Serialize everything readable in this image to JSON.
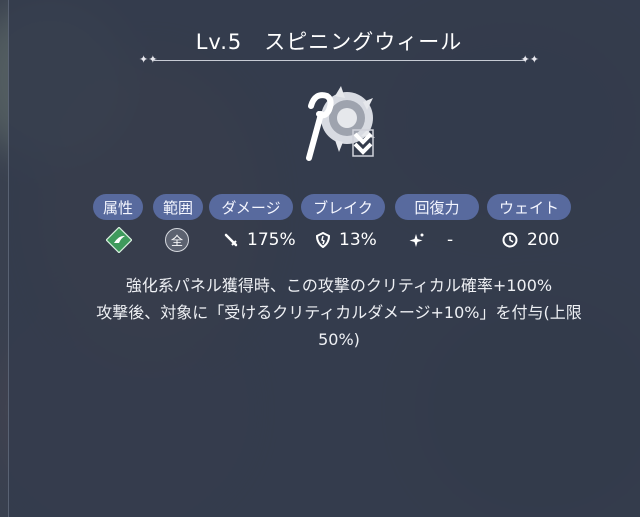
{
  "skill": {
    "level": "Lv.5",
    "name": "スピニングウィール",
    "icon": "spinning-wheel-skill-icon"
  },
  "stats": {
    "labels": {
      "attribute": "属性",
      "range": "範囲",
      "damage": "ダメージ",
      "break": "ブレイク",
      "recovery": "回復力",
      "wait": "ウェイト"
    },
    "values": {
      "attribute_icon": "wind-element-icon",
      "range": "全",
      "damage": "175%",
      "break": "13%",
      "recovery": "-",
      "wait": "200"
    }
  },
  "description": {
    "line1": "強化系パネル獲得時、この攻撃のクリティカル確率+100%",
    "line2": "攻撃後、対象に「受けるクリティカルダメージ+10%」を付与(上限",
    "line3": "50%)"
  },
  "colors": {
    "panel": "#343c4d",
    "pill": "#586a9e",
    "element": "#3f9a5c"
  }
}
